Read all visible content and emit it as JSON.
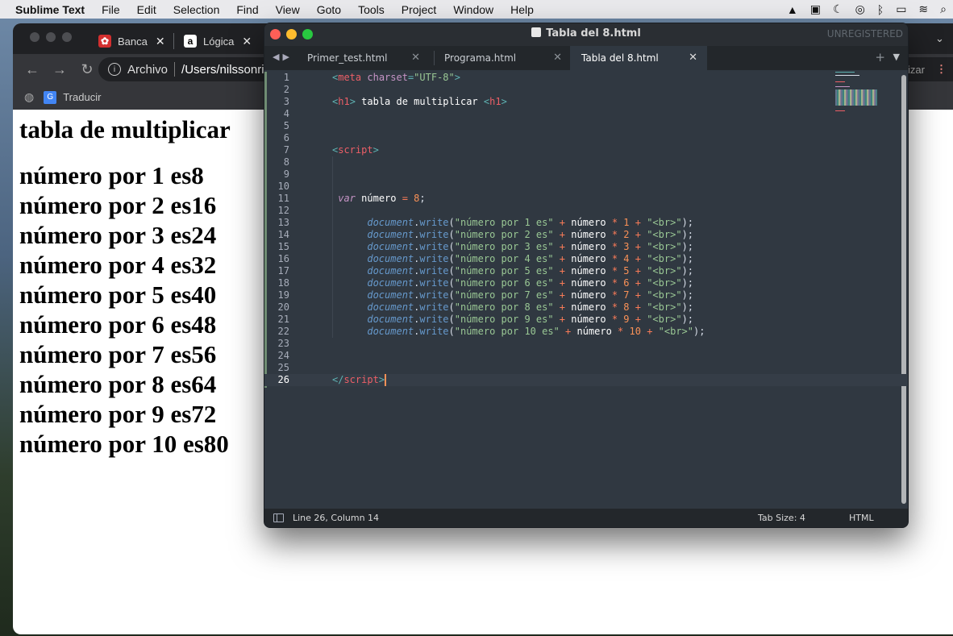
{
  "menubar": {
    "app_name": "Sublime Text",
    "items": [
      "File",
      "Edit",
      "Selection",
      "Find",
      "View",
      "Goto",
      "Tools",
      "Project",
      "Window",
      "Help"
    ],
    "status_icons": [
      "drive-icon",
      "screen-icon",
      "moon-icon",
      "airdrop-icon",
      "bluetooth-icon",
      "battery-icon",
      "wifi-icon",
      "search-icon"
    ]
  },
  "browser": {
    "tabs": [
      {
        "label": "Banca",
        "favicon_color": "#d32f2f"
      },
      {
        "label": "Lógica",
        "favicon_color": "#ffffff"
      }
    ],
    "address": {
      "scheme": "Archivo",
      "path": "/Users/nilssonri"
    },
    "update_button": "izar",
    "bookmark": "Traducir",
    "page": {
      "heading": "tabla de multiplicar",
      "lines": [
        "número por 1 es8",
        "número por 2 es16",
        "número por 3 es24",
        "número por 4 es32",
        "número por 5 es40",
        "número por 6 es48",
        "número por 7 es56",
        "número por 8 es64",
        "número por 9 es72",
        "número por 10 es80"
      ]
    }
  },
  "editor": {
    "window_title": "Tabla del 8.html",
    "license": "UNREGISTERED",
    "tabs": [
      {
        "label": "Primer_test.html",
        "active": false
      },
      {
        "label": "Programa.html",
        "active": false
      },
      {
        "label": "Tabla del 8.html",
        "active": true
      }
    ],
    "current_line": 26,
    "lines": [
      [
        [
          "tag",
          "<"
        ],
        [
          "tagname",
          "meta"
        ],
        [
          "attr",
          " charset"
        ],
        [
          "tag",
          "="
        ],
        [
          "str",
          "\"UTF-8\""
        ],
        [
          "tag",
          ">"
        ]
      ],
      [],
      [
        [
          "tag",
          "<"
        ],
        [
          "tagname",
          "h1"
        ],
        [
          "tag",
          ">"
        ],
        [
          "id",
          " tabla de multiplicar "
        ],
        [
          "tag",
          "<"
        ],
        [
          "tagname",
          "h1"
        ],
        [
          "tag",
          ">"
        ]
      ],
      [],
      [],
      [],
      [
        [
          "tag",
          "<"
        ],
        [
          "tagname",
          "script"
        ],
        [
          "tag",
          ">"
        ]
      ],
      [],
      [],
      [],
      [
        [
          "plain",
          " "
        ],
        [
          "kw",
          "var"
        ],
        [
          "id",
          " número "
        ],
        [
          "op",
          "="
        ],
        [
          "num",
          " 8"
        ],
        [
          "plain",
          ";"
        ]
      ],
      [],
      [
        [
          "plain",
          "      "
        ],
        [
          "obj",
          "document"
        ],
        [
          "plain",
          "."
        ],
        [
          "fn",
          "write"
        ],
        [
          "plain",
          "("
        ],
        [
          "str",
          "\"número por 1 es\""
        ],
        [
          "op",
          " +"
        ],
        [
          "id",
          " número "
        ],
        [
          "op",
          "*"
        ],
        [
          "num",
          " 1 "
        ],
        [
          "op",
          "+"
        ],
        [
          "str",
          " \"<br>\""
        ],
        [
          "plain",
          ");"
        ]
      ],
      [
        [
          "plain",
          "      "
        ],
        [
          "obj",
          "document"
        ],
        [
          "plain",
          "."
        ],
        [
          "fn",
          "write"
        ],
        [
          "plain",
          "("
        ],
        [
          "str",
          "\"número por 2 es\""
        ],
        [
          "op",
          " +"
        ],
        [
          "id",
          " número "
        ],
        [
          "op",
          "*"
        ],
        [
          "num",
          " 2 "
        ],
        [
          "op",
          "+"
        ],
        [
          "str",
          " \"<br>\""
        ],
        [
          "plain",
          ");"
        ]
      ],
      [
        [
          "plain",
          "      "
        ],
        [
          "obj",
          "document"
        ],
        [
          "plain",
          "."
        ],
        [
          "fn",
          "write"
        ],
        [
          "plain",
          "("
        ],
        [
          "str",
          "\"número por 3 es\""
        ],
        [
          "op",
          " +"
        ],
        [
          "id",
          " número "
        ],
        [
          "op",
          "*"
        ],
        [
          "num",
          " 3 "
        ],
        [
          "op",
          "+"
        ],
        [
          "str",
          " \"<br>\""
        ],
        [
          "plain",
          ");"
        ]
      ],
      [
        [
          "plain",
          "      "
        ],
        [
          "obj",
          "document"
        ],
        [
          "plain",
          "."
        ],
        [
          "fn",
          "write"
        ],
        [
          "plain",
          "("
        ],
        [
          "str",
          "\"número por 4 es\""
        ],
        [
          "op",
          " +"
        ],
        [
          "id",
          " número "
        ],
        [
          "op",
          "*"
        ],
        [
          "num",
          " 4 "
        ],
        [
          "op",
          "+"
        ],
        [
          "str",
          " \"<br>\""
        ],
        [
          "plain",
          ");"
        ]
      ],
      [
        [
          "plain",
          "      "
        ],
        [
          "obj",
          "document"
        ],
        [
          "plain",
          "."
        ],
        [
          "fn",
          "write"
        ],
        [
          "plain",
          "("
        ],
        [
          "str",
          "\"número por 5 es\""
        ],
        [
          "op",
          " +"
        ],
        [
          "id",
          " número "
        ],
        [
          "op",
          "*"
        ],
        [
          "num",
          " 5 "
        ],
        [
          "op",
          "+"
        ],
        [
          "str",
          " \"<br>\""
        ],
        [
          "plain",
          ");"
        ]
      ],
      [
        [
          "plain",
          "      "
        ],
        [
          "obj",
          "document"
        ],
        [
          "plain",
          "."
        ],
        [
          "fn",
          "write"
        ],
        [
          "plain",
          "("
        ],
        [
          "str",
          "\"número por 6 es\""
        ],
        [
          "op",
          " +"
        ],
        [
          "id",
          " número "
        ],
        [
          "op",
          "*"
        ],
        [
          "num",
          " 6 "
        ],
        [
          "op",
          "+"
        ],
        [
          "str",
          " \"<br>\""
        ],
        [
          "plain",
          ");"
        ]
      ],
      [
        [
          "plain",
          "      "
        ],
        [
          "obj",
          "document"
        ],
        [
          "plain",
          "."
        ],
        [
          "fn",
          "write"
        ],
        [
          "plain",
          "("
        ],
        [
          "str",
          "\"número por 7 es\""
        ],
        [
          "op",
          " +"
        ],
        [
          "id",
          " número "
        ],
        [
          "op",
          "*"
        ],
        [
          "num",
          " 7 "
        ],
        [
          "op",
          "+"
        ],
        [
          "str",
          " \"<br>\""
        ],
        [
          "plain",
          ");"
        ]
      ],
      [
        [
          "plain",
          "      "
        ],
        [
          "obj",
          "document"
        ],
        [
          "plain",
          "."
        ],
        [
          "fn",
          "write"
        ],
        [
          "plain",
          "("
        ],
        [
          "str",
          "\"número por 8 es\""
        ],
        [
          "op",
          " +"
        ],
        [
          "id",
          " número "
        ],
        [
          "op",
          "*"
        ],
        [
          "num",
          " 8 "
        ],
        [
          "op",
          "+"
        ],
        [
          "str",
          " \"<br>\""
        ],
        [
          "plain",
          ");"
        ]
      ],
      [
        [
          "plain",
          "      "
        ],
        [
          "obj",
          "document"
        ],
        [
          "plain",
          "."
        ],
        [
          "fn",
          "write"
        ],
        [
          "plain",
          "("
        ],
        [
          "str",
          "\"número por 9 es\""
        ],
        [
          "op",
          " +"
        ],
        [
          "id",
          " número "
        ],
        [
          "op",
          "*"
        ],
        [
          "num",
          " 9 "
        ],
        [
          "op",
          "+"
        ],
        [
          "str",
          " \"<br>\""
        ],
        [
          "plain",
          ");"
        ]
      ],
      [
        [
          "plain",
          "      "
        ],
        [
          "obj",
          "document"
        ],
        [
          "plain",
          "."
        ],
        [
          "fn",
          "write"
        ],
        [
          "plain",
          "("
        ],
        [
          "str",
          "\"número por 10 es\""
        ],
        [
          "op",
          " +"
        ],
        [
          "id",
          " número "
        ],
        [
          "op",
          "*"
        ],
        [
          "num",
          " 10 "
        ],
        [
          "op",
          "+"
        ],
        [
          "str",
          " \"<br>\""
        ],
        [
          "plain",
          ");"
        ]
      ],
      [],
      [],
      [],
      [
        [
          "tag",
          "</"
        ],
        [
          "tagname",
          "script"
        ],
        [
          "tag",
          ">"
        ]
      ]
    ],
    "status": {
      "position": "Line 26, Column 14",
      "tab_size": "Tab Size: 4",
      "syntax": "HTML"
    }
  }
}
